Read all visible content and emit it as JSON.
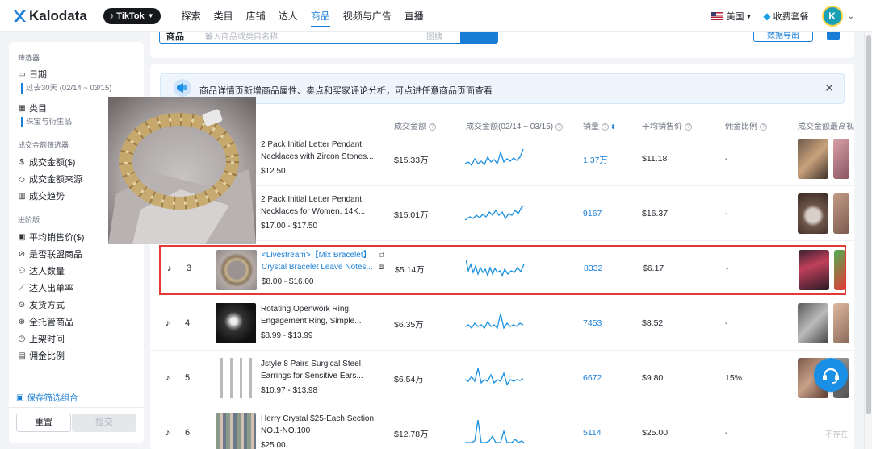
{
  "nav": {
    "logo": "Kalodata",
    "platform": "TikTok",
    "items": [
      "探索",
      "类目",
      "店铺",
      "达人",
      "商品",
      "视频与广告",
      "直播"
    ],
    "active_index": 4,
    "country": "美国",
    "vip": "收费套餐",
    "avatar_letter": "K"
  },
  "sidebar": {
    "filters_title": "筛选器",
    "date_label": "日期",
    "date_value": "过去30天 (02/14 ~ 03/15)",
    "category_label": "类目",
    "category_value": "珠宝与衍生品",
    "gmv_group": "成交金额筛选器",
    "gmv_items": [
      "成交金额($)",
      "成交金额来源",
      "成交趋势"
    ],
    "advanced_group": "进阶版",
    "advanced_items": [
      "平均销售价($)",
      "是否联盟商品",
      "达人数量",
      "达人出单率",
      "发货方式",
      "全托管商品",
      "上架时间",
      "佣金比例"
    ],
    "save_combo": "保存筛选组合",
    "reset": "重置",
    "submit": "提交"
  },
  "search": {
    "label": "商品",
    "placeholder": "输入商品或类目名称",
    "image_search": "图搜",
    "export": "数据导出"
  },
  "notice": {
    "text": "商品详情页新增商品属性、卖点和买家评论分析，可点进任意商品页面查看"
  },
  "table": {
    "headers": {
      "gmv": "成交金额",
      "trend": "成交金额(02/14 ~ 03/15)",
      "sales": "销量",
      "avg_price": "平均销售价",
      "commission": "佣金比例",
      "top_video": "成交金额最高视"
    },
    "rows": [
      {
        "rank": "",
        "name": "2 Pack Initial Letter Pendant Necklaces with Zircon Stones...",
        "price": "$12.50",
        "gmv": "$15.33万",
        "sales": "1.37万",
        "avg_price": "$11.18",
        "commission": "-"
      },
      {
        "rank": "",
        "name": "2 Pack Initial Letter Pendant Necklaces for Women, 14K...",
        "price": "$17.00 - $17.50",
        "gmv": "$15.01万",
        "sales": "9167",
        "avg_price": "$16.37",
        "commission": "-"
      },
      {
        "rank": "3",
        "name": "<Livestream>【Mix Bracelet】 Crystal Bracelet Leave Notes...",
        "price": "$8.00 - $16.00",
        "gmv": "$5.14万",
        "sales": "8332",
        "avg_price": "$6.17",
        "commission": "-"
      },
      {
        "rank": "4",
        "name": "Rotating Openwork Ring, Engagement Ring, Simple...",
        "price": "$8.99 - $13.99",
        "gmv": "$6.35万",
        "sales": "7453",
        "avg_price": "$8.52",
        "commission": "-"
      },
      {
        "rank": "5",
        "name": "Jstyle 8 Pairs Surgical Steel Earrings for Sensitive Ears...",
        "price": "$10.97 - $13.98",
        "gmv": "$6.54万",
        "sales": "6672",
        "avg_price": "$9.80",
        "commission": "15%"
      },
      {
        "rank": "6",
        "name": "Herry Crystal $25-Each Section NO.1-NO.100",
        "price": "$25.00",
        "gmv": "$12.78万",
        "sales": "5114",
        "avg_price": "$25.00",
        "commission": "-"
      }
    ],
    "no_content": "不存在"
  },
  "colors": {
    "accent": "#1a7ed6",
    "highlight_border": "#e53935",
    "spark_line": "#1a90e0"
  }
}
